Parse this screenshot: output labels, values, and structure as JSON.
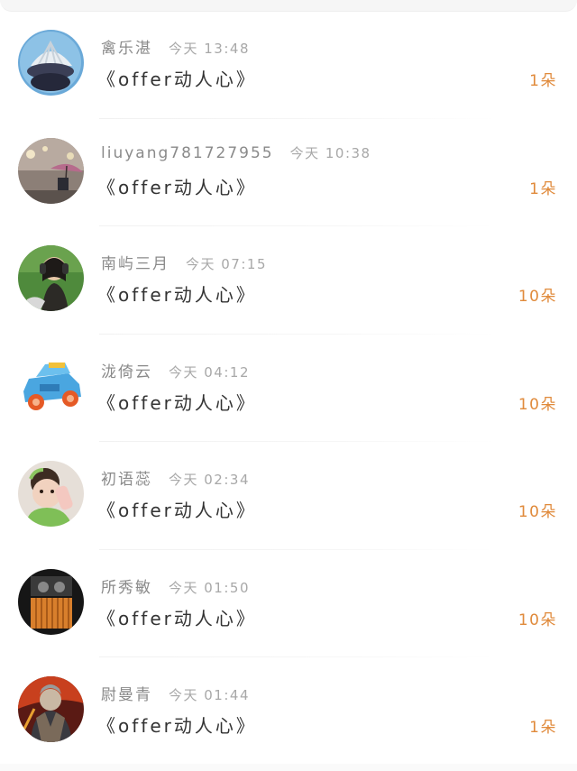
{
  "accent_color": "#e08a3b",
  "gift_list": [
    {
      "user": "禽乐湛",
      "time": "今天 13:48",
      "gift": "《offer动人心》",
      "count": "1朵",
      "avatar_icon": "shell-cupcake-avatar"
    },
    {
      "user": "liuyang781727955",
      "time": "今天 10:38",
      "gift": "《offer动人心》",
      "count": "1朵",
      "avatar_icon": "rainy-umbrella-avatar"
    },
    {
      "user": "南屿三月",
      "time": "今天 07:15",
      "gift": "《offer动人心》",
      "count": "10朵",
      "avatar_icon": "girl-headphones-avatar"
    },
    {
      "user": "泷倚云",
      "time": "今天 04:12",
      "gift": "《offer动人心》",
      "count": "10朵",
      "avatar_icon": "toy-car-avatar"
    },
    {
      "user": "初语蕊",
      "time": "今天 02:34",
      "gift": "《offer动人心》",
      "count": "10朵",
      "avatar_icon": "baby-bottle-avatar"
    },
    {
      "user": "所秀敏",
      "time": "今天 01:50",
      "gift": "《offer动人心》",
      "count": "10朵",
      "avatar_icon": "dark-box-avatar"
    },
    {
      "user": "尉曼青",
      "time": "今天 01:44",
      "gift": "《offer动人心》",
      "count": "1朵",
      "avatar_icon": "warrior-avatar"
    }
  ]
}
